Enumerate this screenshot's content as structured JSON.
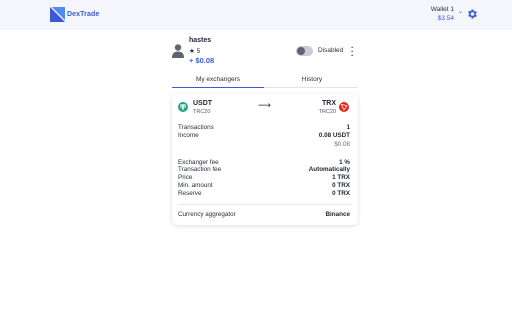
{
  "brand": {
    "name": "DexTrade",
    "color": "#3b5bd6"
  },
  "wallet": {
    "name": "Wallet 1",
    "balance": "$3.54"
  },
  "profile": {
    "username": "hastes",
    "rating_star": "★",
    "rating": "5",
    "balance": "+ $0.08",
    "status_label": "Disabled",
    "enabled": false
  },
  "tabs": [
    {
      "label": "My exchangers",
      "active": true
    },
    {
      "label": "History",
      "active": false
    }
  ],
  "exchanger": {
    "from": {
      "code": "USDT",
      "network": "TRC20",
      "icon": "tether-icon",
      "color": "#26a17b"
    },
    "arrow": "⟶",
    "to": {
      "code": "TRX",
      "network": "TRC20",
      "icon": "tron-icon",
      "color": "#e4261d"
    },
    "stats": [
      {
        "label": "Transactions",
        "value": "1"
      },
      {
        "label": "Income",
        "value": "0.08 USDT"
      },
      {
        "label": "",
        "value": "$0.08"
      }
    ],
    "fees": [
      {
        "label": "Exchanger fee",
        "value": "1 %"
      },
      {
        "label": "Transaction fee",
        "value": "Automatically"
      },
      {
        "label": "Price",
        "value": "1 TRX"
      },
      {
        "label": "Min. amount",
        "value": "0 TRX"
      },
      {
        "label": "Reserve",
        "value": "0 TRX"
      }
    ],
    "aggregator": {
      "label": "Currency aggregator",
      "value": "Binance"
    }
  }
}
